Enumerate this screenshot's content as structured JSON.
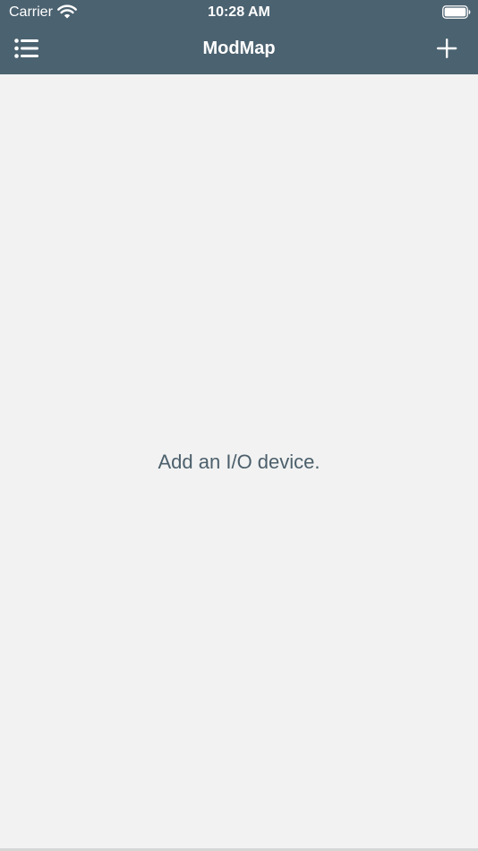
{
  "status_bar": {
    "carrier": "Carrier",
    "time": "10:28 AM",
    "wifi_icon": "wifi-icon",
    "battery_icon": "battery-icon"
  },
  "nav": {
    "title": "ModMap",
    "left_icon": "list-menu-icon",
    "right_icon": "plus-icon"
  },
  "content": {
    "empty_message": "Add an I/O device."
  },
  "colors": {
    "header": "#4b6270",
    "background": "#f2f2f2",
    "message_text": "#4b5f6b",
    "header_text": "#ffffff"
  }
}
